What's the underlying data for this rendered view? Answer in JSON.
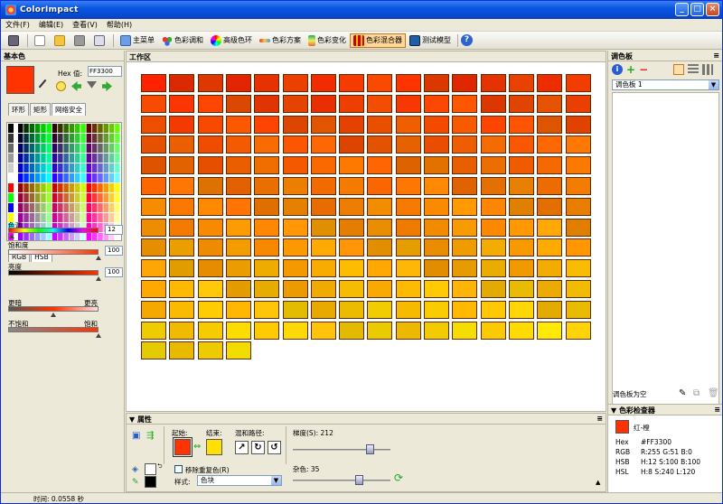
{
  "window": {
    "title": "ColorImpact"
  },
  "menu": [
    "文件(F)",
    "编辑(E)",
    "查看(V)",
    "帮助(H)"
  ],
  "toolbar": {
    "items": [
      "主菜单",
      "色彩调和",
      "高级色环",
      "色彩方案",
      "色彩变化",
      "色彩混合器",
      "测试模型"
    ],
    "active": "色彩混合器"
  },
  "left": {
    "title": "基本色",
    "hex_label": "Hex 值:",
    "hex_value": "FF3300",
    "base_color": "#FF3300",
    "tabs": [
      "环形",
      "矩形",
      "网络安全"
    ],
    "mode_tabs": [
      "RGB",
      "HSB"
    ],
    "hue_label": "色调",
    "hue_value": "12",
    "sat_label": "饱和度",
    "sat_value": "100",
    "bri_label": "亮度",
    "bri_value": "100",
    "darker": "更暗",
    "brighter": "更亮",
    "unsat": "不饱和",
    "sat": "饱和"
  },
  "workspace": {
    "title": "工作区",
    "rows": 14,
    "cols": 16,
    "last_row_count": 4
  },
  "palette": {
    "title": "调色板",
    "selected": "调色板 1",
    "empty_text": "调色板为空"
  },
  "inspector": {
    "title": "色彩检查器",
    "swatch": "#FF3300",
    "name": "红-橙",
    "rows": [
      {
        "k": "Hex",
        "v": "#FF3300"
      },
      {
        "k": "RGB",
        "v": "R:255  G:51  B:0"
      },
      {
        "k": "HSB",
        "v": "H:12  S:100  B:100"
      },
      {
        "k": "HSL",
        "v": "H:8  S:240  L:120"
      }
    ]
  },
  "props": {
    "title": "属性",
    "start_label": "起始:",
    "start_color": "#FF3300",
    "end_label": "结束:",
    "end_color": "#FFE000",
    "path_label": "混和路径:",
    "gradient_label": "梯度(S): 212",
    "noise_label": "杂色: 35",
    "remove_dup": "移除重复色(R)",
    "style_label": "样式:",
    "style_value": "色块"
  },
  "status": {
    "time": "时间: 0.0558 秒"
  }
}
